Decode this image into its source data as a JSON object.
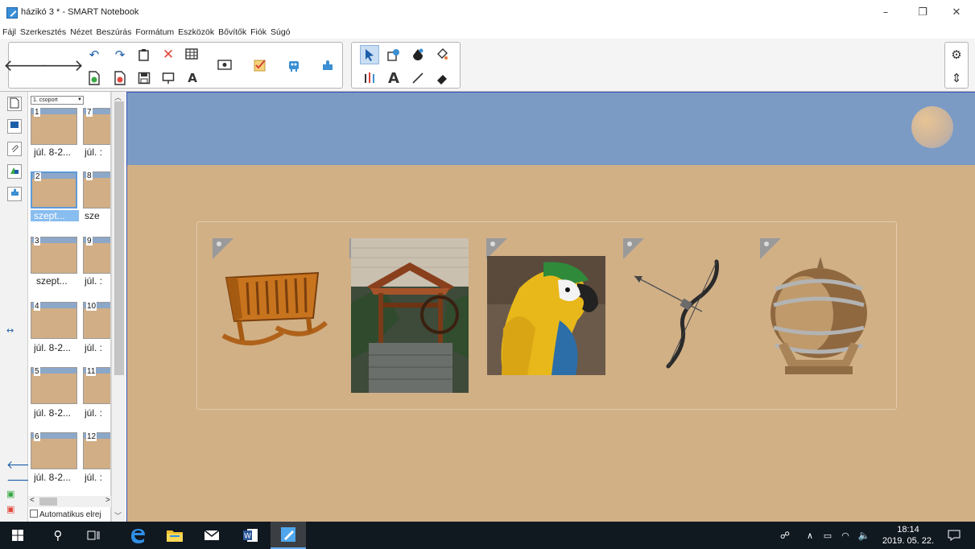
{
  "window": {
    "title": "házikó 3 * - SMART Notebook",
    "min_icon": "–",
    "restore_icon": "❐",
    "close_icon": "✕"
  },
  "menu": [
    "Fájl",
    "Szerkesztés",
    "Nézet",
    "Beszúrás",
    "Formátum",
    "Eszközök",
    "Bővítők",
    "Fiók",
    "Súgó"
  ],
  "toolbar": {
    "back_icon": "🡐",
    "forward_icon": "🡒",
    "undo_icon": "↶",
    "redo_icon": "↷",
    "delete_icon": "✕",
    "text_icon": "A",
    "settings_icon": "⚙",
    "expand_icon": "⇕"
  },
  "sorter": {
    "group": "1. csoport",
    "auto_label": "Automatikus elrej",
    "pages": [
      {
        "num": "1",
        "label": "júl. 8-2..."
      },
      {
        "num": "7",
        "label": "júl. :"
      },
      {
        "num": "2",
        "label": "szept..."
      },
      {
        "num": "8",
        "label": "sze"
      },
      {
        "num": "3",
        "label": "szept..."
      },
      {
        "num": "9",
        "label": "júl. :"
      },
      {
        "num": "4",
        "label": "júl. 8-2..."
      },
      {
        "num": "10",
        "label": "júl. :"
      },
      {
        "num": "5",
        "label": "júl. 8-2..."
      },
      {
        "num": "11",
        "label": "júl. :"
      },
      {
        "num": "6",
        "label": "júl. 8-2..."
      },
      {
        "num": "12",
        "label": "júl. :"
      }
    ]
  },
  "canvas": {
    "colors": {
      "sky": "#7b9bc5",
      "ground": "#d1b086"
    },
    "images": [
      "cradle",
      "well",
      "parrot",
      "bow",
      "barrel"
    ]
  },
  "taskbar": {
    "time": "18:14",
    "date": "2019. 05. 22."
  }
}
